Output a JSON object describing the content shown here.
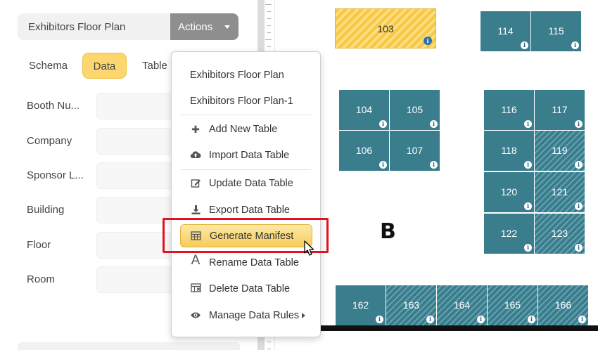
{
  "sidebar": {
    "title": "Exhibitors Floor Plan",
    "actions_label": "Actions",
    "tabs": [
      {
        "label": "Schema"
      },
      {
        "label": "Data"
      },
      {
        "label": "Table"
      }
    ],
    "active_tab": "Data",
    "fields": [
      {
        "label": "Booth Nu..."
      },
      {
        "label": "Company"
      },
      {
        "label": "Sponsor L..."
      },
      {
        "label": "Building"
      },
      {
        "label": "Floor"
      },
      {
        "label": "Room"
      }
    ]
  },
  "menu": {
    "items": [
      {
        "label": "Exhibitors Floor Plan",
        "icon": ""
      },
      {
        "label": "Exhibitors Floor Plan-1",
        "icon": ""
      },
      {
        "label": "Add New Table",
        "icon": "plus-icon"
      },
      {
        "label": "Import Data Table",
        "icon": "cloud-upload-icon"
      },
      {
        "label": "Update Data Table",
        "icon": "edit-icon"
      },
      {
        "label": "Export Data Table",
        "icon": "download-icon"
      },
      {
        "label": "Generate Manifest",
        "icon": "table-icon"
      },
      {
        "label": "Rename Data Table",
        "icon": "font-icon"
      },
      {
        "label": "Delete Data Table",
        "icon": "table-delete-icon"
      },
      {
        "label": "Manage Data Rules",
        "icon": "eye-icon"
      }
    ],
    "highlighted": "Generate Manifest"
  },
  "floor_plan": {
    "section_label": "B",
    "info_glyph": "i",
    "booths": [
      {
        "number": "103",
        "status": "highlighted"
      },
      {
        "number": "104",
        "status": "booked"
      },
      {
        "number": "105",
        "status": "booked"
      },
      {
        "number": "106",
        "status": "booked"
      },
      {
        "number": "107",
        "status": "booked"
      },
      {
        "number": "114",
        "status": "booked"
      },
      {
        "number": "115",
        "status": "booked"
      },
      {
        "number": "116",
        "status": "booked"
      },
      {
        "number": "117",
        "status": "booked"
      },
      {
        "number": "118",
        "status": "booked"
      },
      {
        "number": "119",
        "status": "available"
      },
      {
        "number": "120",
        "status": "booked"
      },
      {
        "number": "121",
        "status": "available"
      },
      {
        "number": "122",
        "status": "booked"
      },
      {
        "number": "123",
        "status": "available"
      },
      {
        "number": "162",
        "status": "booked"
      },
      {
        "number": "163",
        "status": "available"
      },
      {
        "number": "164",
        "status": "available"
      },
      {
        "number": "165",
        "status": "available"
      },
      {
        "number": "166",
        "status": "available"
      }
    ]
  },
  "colors": {
    "accent_yellow": "#fcd66e",
    "booth_teal": "#3a7d8d",
    "highlight_red": "#e0131f"
  }
}
